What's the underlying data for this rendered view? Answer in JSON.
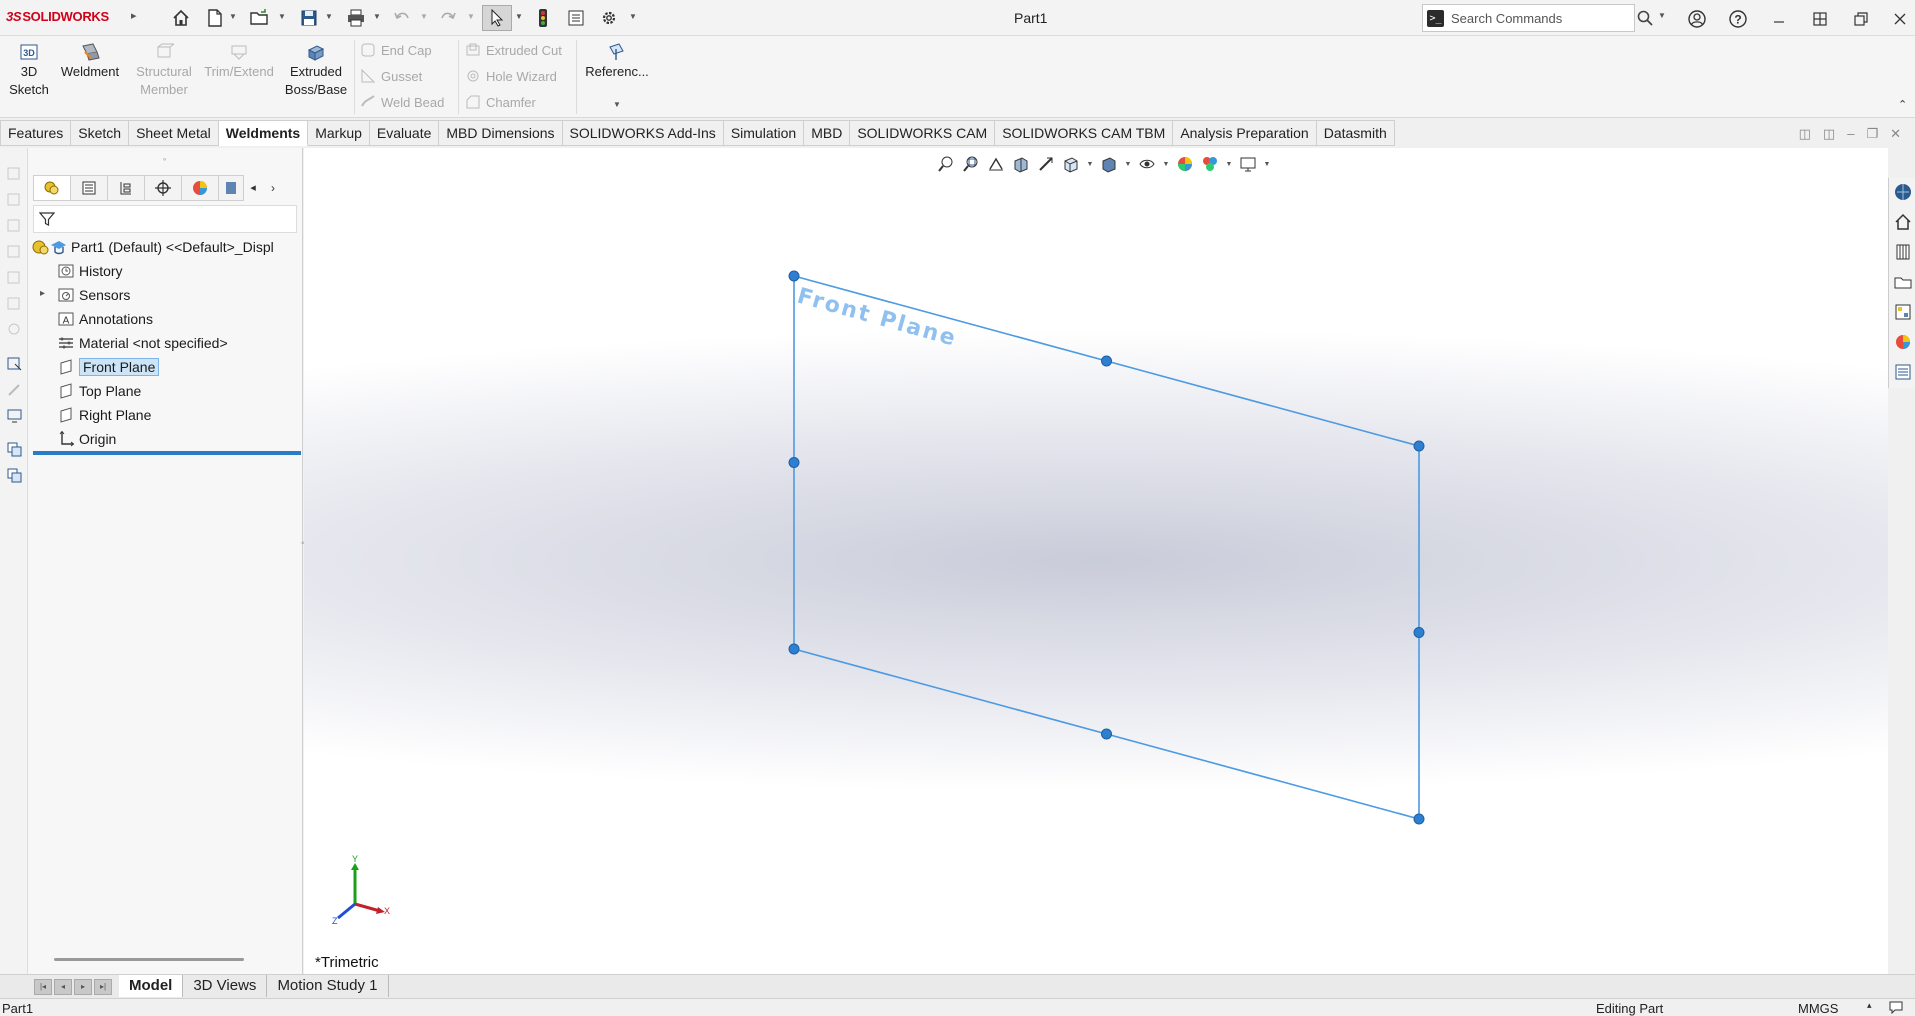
{
  "app": {
    "logo_text": "SOLIDWORKS",
    "logo_prefix": "3S",
    "doc_title": "Part1",
    "search_placeholder": "Search Commands"
  },
  "command_manager": {
    "big_buttons": [
      {
        "label": "3D\nSketch",
        "enabled": true
      },
      {
        "label": "Weldment",
        "enabled": true
      },
      {
        "label": "Structural\nMember",
        "enabled": false
      },
      {
        "label": "Trim/Extend",
        "enabled": false
      },
      {
        "label": "Extruded\nBoss/Base",
        "enabled": true
      },
      {
        "label": "Referenc...",
        "enabled": true
      }
    ],
    "small_buttons": [
      {
        "label": "End Cap",
        "enabled": false
      },
      {
        "label": "Gusset",
        "enabled": false
      },
      {
        "label": "Weld Bead",
        "enabled": false
      },
      {
        "label": "Extruded Cut",
        "enabled": false
      },
      {
        "label": "Hole Wizard",
        "enabled": false
      },
      {
        "label": "Chamfer",
        "enabled": false
      }
    ]
  },
  "tabs": [
    {
      "label": "Features",
      "active": false
    },
    {
      "label": "Sketch",
      "active": false
    },
    {
      "label": "Sheet Metal",
      "active": false
    },
    {
      "label": "Weldments",
      "active": true
    },
    {
      "label": "Markup",
      "active": false
    },
    {
      "label": "Evaluate",
      "active": false
    },
    {
      "label": "MBD Dimensions",
      "active": false
    },
    {
      "label": "SOLIDWORKS Add-Ins",
      "active": false
    },
    {
      "label": "Simulation",
      "active": false
    },
    {
      "label": "MBD",
      "active": false
    },
    {
      "label": "SOLIDWORKS CAM",
      "active": false
    },
    {
      "label": "SOLIDWORKS CAM TBM",
      "active": false
    },
    {
      "label": "Analysis Preparation",
      "active": false
    },
    {
      "label": "Datasmith",
      "active": false
    }
  ],
  "feature_tree": {
    "root": "Part1 (Default) <<Default>_Displ",
    "items": [
      {
        "label": "History",
        "icon": "history-folder-icon"
      },
      {
        "label": "Sensors",
        "icon": "sensors-folder-icon"
      },
      {
        "label": "Annotations",
        "icon": "annotations-icon",
        "expandable": true
      },
      {
        "label": "Material <not specified>",
        "icon": "material-icon"
      },
      {
        "label": "Front Plane",
        "icon": "plane-icon",
        "selected": true
      },
      {
        "label": "Top Plane",
        "icon": "plane-icon"
      },
      {
        "label": "Right Plane",
        "icon": "plane-icon"
      },
      {
        "label": "Origin",
        "icon": "origin-icon"
      }
    ]
  },
  "graphics": {
    "plane_label": "Front Plane",
    "view_orientation": "*Trimetric",
    "triad_labels": {
      "x": "X",
      "y": "Y",
      "z": "Z"
    },
    "plane_color": "#4b9ae3"
  },
  "bottom_tabs": [
    {
      "label": "Model",
      "active": true
    },
    {
      "label": "3D Views",
      "active": false
    },
    {
      "label": "Motion Study 1",
      "active": false
    }
  ],
  "status_bar": {
    "doc": "Part1",
    "mode": "Editing Part",
    "units": "MMGS"
  }
}
